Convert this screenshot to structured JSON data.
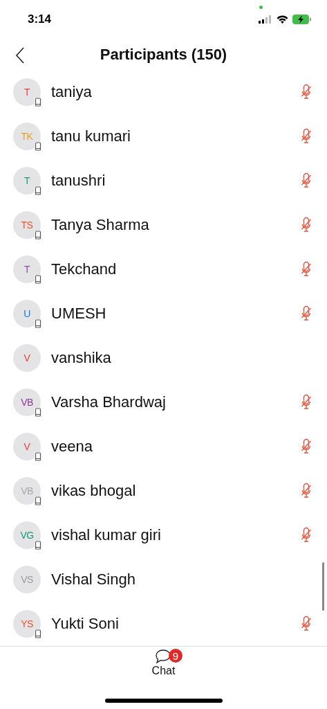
{
  "status_bar": {
    "time": "3:14"
  },
  "nav": {
    "title": "Participants (150)"
  },
  "participants": [
    {
      "initials": "T",
      "color": "#e0463a",
      "name": "taniya",
      "mobile": true,
      "muted": true
    },
    {
      "initials": "TK",
      "color": "#e8a020",
      "name": "tanu kumari",
      "mobile": true,
      "muted": true
    },
    {
      "initials": "T",
      "color": "#1f9a78",
      "name": "tanushri",
      "mobile": true,
      "muted": true
    },
    {
      "initials": "TS",
      "color": "#e8552a",
      "name": "Tanya Sharma",
      "mobile": true,
      "muted": true
    },
    {
      "initials": "T",
      "color": "#8a4a9a",
      "name": "Tekchand",
      "mobile": true,
      "muted": true
    },
    {
      "initials": "U",
      "color": "#1a7ad4",
      "name": "UMESH",
      "mobile": true,
      "muted": true
    },
    {
      "initials": "V",
      "color": "#e0463a",
      "name": "vanshika",
      "mobile": false,
      "muted": false
    },
    {
      "initials": "VB",
      "color": "#8a3a9a",
      "name": "Varsha Bhardwaj",
      "mobile": true,
      "muted": true
    },
    {
      "initials": "V",
      "color": "#e0463a",
      "name": "veena",
      "mobile": true,
      "muted": true
    },
    {
      "initials": "VB",
      "color": "#a8a8a8",
      "name": "vikas bhogal",
      "mobile": true,
      "muted": true
    },
    {
      "initials": "VG",
      "color": "#1f9a78",
      "name": "vishal kumar giri",
      "mobile": true,
      "muted": true
    },
    {
      "initials": "VS",
      "color": "#9a9a9a",
      "name": "Vishal Singh",
      "mobile": false,
      "muted": false
    },
    {
      "initials": "YS",
      "color": "#e8552a",
      "name": "Yukti Soni",
      "mobile": true,
      "muted": true
    }
  ],
  "footer": {
    "label": "Chat",
    "badge": "9"
  }
}
